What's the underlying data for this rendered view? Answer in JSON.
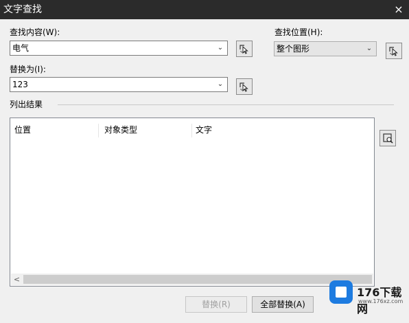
{
  "window": {
    "title": "文字查找",
    "close_glyph": "×"
  },
  "find_what": {
    "label": "查找内容(W):",
    "value": "电气",
    "icon": "pick-select-icon"
  },
  "replace_with": {
    "label": "替换为(I):",
    "value": "123",
    "icon": "pick-select-icon"
  },
  "find_where": {
    "label": "查找位置(H):",
    "value": "整个图形",
    "icon": "pick-select-icon"
  },
  "results": {
    "group_label": "列出结果",
    "columns": [
      "位置",
      "对象类型",
      "文字"
    ],
    "zoom_icon": "zoom-to-icon",
    "scroll_left": "<"
  },
  "buttons": {
    "replace": "替换(R)",
    "replace_all": "全部替换(A)"
  },
  "watermark": {
    "brand": "176下载网",
    "url": "www.176xz.com"
  }
}
